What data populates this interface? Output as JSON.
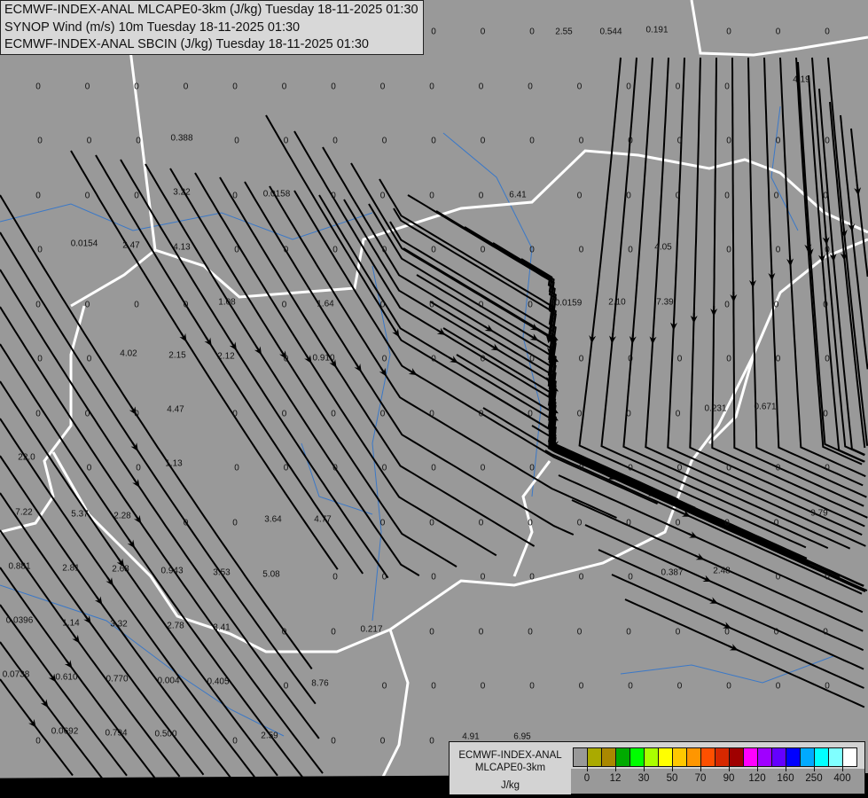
{
  "header": {
    "lines": [
      "ECMWF-INDEX-ANAL MLCAPE0-3km (J/kg) Tuesday 18-11-2025 01:30",
      "SYNOP Wind (m/s) 10m Tuesday 18-11-2025 01:30",
      "ECMWF-INDEX-ANAL SBCIN (J/kg) Tuesday 18-11-2025 01:30"
    ]
  },
  "map": {
    "zero_label": "0",
    "values": [
      "0.388",
      "3.22",
      "0.0158",
      "0.0154",
      "2.47",
      "4.13",
      "1.08",
      "1.64",
      "4.02",
      "2.15",
      "2.12",
      "0.910",
      "4.47",
      "1.13",
      "22.0",
      "7.22",
      "5.37",
      "2.28",
      "3.64",
      "4.77",
      "0.881",
      "2.81",
      "2.68",
      "0.943",
      "3.53",
      "5.08",
      "0.0396",
      "1.14",
      "3.32",
      "2.78",
      "3.41",
      "0.217",
      "0.0738",
      "0.610",
      "0.770",
      "0.004",
      "0.405",
      "8.76",
      "0.0692",
      "0.794",
      "0.500",
      "2.59",
      "4.91",
      "6.95",
      "2.55",
      "0.544",
      "0.191",
      "4.19",
      "6.41",
      "4.05",
      "0.0159",
      "2.10",
      "7.39",
      "0.231",
      "0.671",
      "9.79",
      "0.387",
      "2.48"
    ]
  },
  "legend": {
    "title_line1": "ECMWF-INDEX-ANAL",
    "title_line2": "MLCAPE0-3km",
    "unit": "J/kg",
    "colors": [
      "#999999",
      "#aaaa00",
      "#aa8800",
      "#00aa00",
      "#00ff00",
      "#aaff00",
      "#ffff00",
      "#ffc800",
      "#ff9600",
      "#ff5000",
      "#d72800",
      "#a00000",
      "#ff00ff",
      "#a000ff",
      "#6400ff",
      "#0000ff",
      "#00aaff",
      "#00ffff",
      "#80ffff",
      "#ffffff"
    ],
    "ticks": [
      "0",
      "12",
      "30",
      "50",
      "70",
      "90",
      "120",
      "160",
      "250",
      "400"
    ]
  }
}
